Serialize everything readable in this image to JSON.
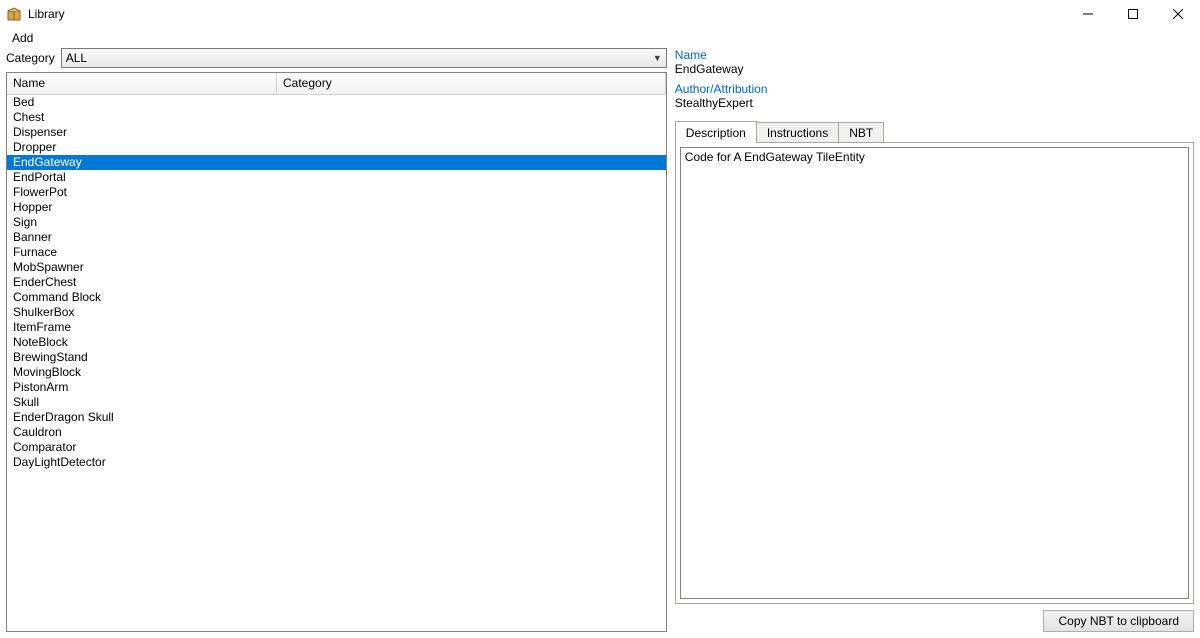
{
  "window": {
    "title": "Library"
  },
  "menubar": {
    "add": "Add"
  },
  "filter": {
    "label": "Category",
    "value": "ALL"
  },
  "columns": {
    "name": "Name",
    "category": "Category"
  },
  "items": [
    {
      "name": "Bed"
    },
    {
      "name": "Chest"
    },
    {
      "name": "Dispenser"
    },
    {
      "name": "Dropper"
    },
    {
      "name": "EndGateway",
      "selected": true
    },
    {
      "name": "EndPortal"
    },
    {
      "name": "FlowerPot"
    },
    {
      "name": "Hopper"
    },
    {
      "name": "Sign"
    },
    {
      "name": "Banner"
    },
    {
      "name": "Furnace"
    },
    {
      "name": "MobSpawner"
    },
    {
      "name": "EnderChest"
    },
    {
      "name": "Command Block"
    },
    {
      "name": "ShulkerBox"
    },
    {
      "name": "ItemFrame"
    },
    {
      "name": "NoteBlock"
    },
    {
      "name": "BrewingStand"
    },
    {
      "name": "MovingBlock"
    },
    {
      "name": "PistonArm"
    },
    {
      "name": "Skull"
    },
    {
      "name": "EnderDragon Skull"
    },
    {
      "name": "Cauldron"
    },
    {
      "name": "Comparator"
    },
    {
      "name": "DayLightDetector"
    }
  ],
  "details": {
    "name_label": "Name",
    "name_value": "EndGateway",
    "author_label": "Author/Attribution",
    "author_value": "StealthyExpert"
  },
  "tabs": {
    "description": "Description",
    "instructions": "Instructions",
    "nbt": "NBT"
  },
  "description_text": "Code for A EndGateway TileEntity",
  "buttons": {
    "copy": "Copy NBT to clipboard"
  }
}
